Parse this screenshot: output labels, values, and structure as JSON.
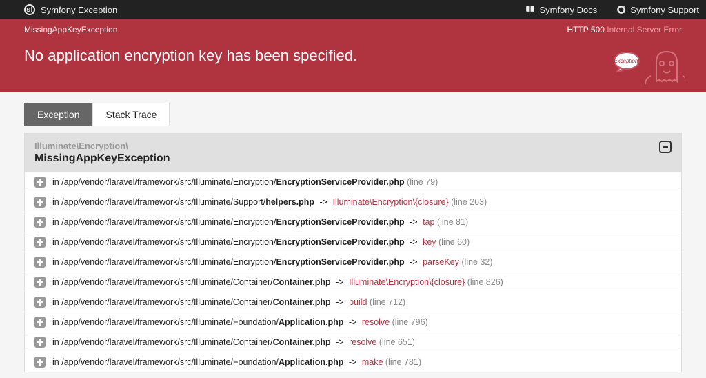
{
  "topbar": {
    "title": "Symfony Exception",
    "docs": "Symfony Docs",
    "support": "Symfony Support"
  },
  "banner": {
    "exception_label": "MissingAppKeyException",
    "http_code": "HTTP 500",
    "http_text": "Internal Server Error",
    "heading": "No application encryption key has been specified.",
    "bubble_text": "Exception!"
  },
  "tabs": {
    "exception": "Exception",
    "stack": "Stack Trace"
  },
  "exception_head": {
    "namespace": "Illuminate\\Encryption\\",
    "class": "MissingAppKeyException"
  },
  "rows": [
    {
      "in": "in",
      "path": "/app/vendor/laravel/framework/src/Illuminate/Encryption/",
      "file": "EncryptionServiceProvider.php",
      "fn": "",
      "line": "(line 79)"
    },
    {
      "in": "in",
      "path": "/app/vendor/laravel/framework/src/Illuminate/Support/",
      "file": "helpers.php",
      "fn": "Illuminate\\Encryption\\{closure}",
      "line": "(line 263)"
    },
    {
      "in": "in",
      "path": "/app/vendor/laravel/framework/src/Illuminate/Encryption/",
      "file": "EncryptionServiceProvider.php",
      "fn": "tap",
      "line": "(line 81)"
    },
    {
      "in": "in",
      "path": "/app/vendor/laravel/framework/src/Illuminate/Encryption/",
      "file": "EncryptionServiceProvider.php",
      "fn": "key",
      "line": "(line 60)"
    },
    {
      "in": "in",
      "path": "/app/vendor/laravel/framework/src/Illuminate/Encryption/",
      "file": "EncryptionServiceProvider.php",
      "fn": "parseKey",
      "line": "(line 32)"
    },
    {
      "in": "in",
      "path": "/app/vendor/laravel/framework/src/Illuminate/Container/",
      "file": "Container.php",
      "fn": "Illuminate\\Encryption\\{closure}",
      "line": "(line 826)"
    },
    {
      "in": "in",
      "path": "/app/vendor/laravel/framework/src/Illuminate/Container/",
      "file": "Container.php",
      "fn": "build",
      "line": "(line 712)"
    },
    {
      "in": "in",
      "path": "/app/vendor/laravel/framework/src/Illuminate/Foundation/",
      "file": "Application.php",
      "fn": "resolve",
      "line": "(line 796)"
    },
    {
      "in": "in",
      "path": "/app/vendor/laravel/framework/src/Illuminate/Container/",
      "file": "Container.php",
      "fn": "resolve",
      "line": "(line 651)"
    },
    {
      "in": "in",
      "path": "/app/vendor/laravel/framework/src/Illuminate/Foundation/",
      "file": "Application.php",
      "fn": "make",
      "line": "(line 781)"
    }
  ]
}
